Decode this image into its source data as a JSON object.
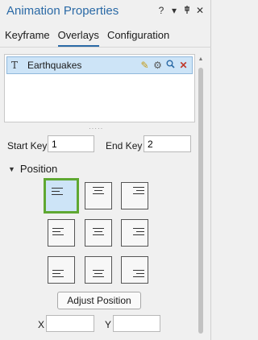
{
  "window": {
    "title": "Animation Properties",
    "help_icon": "?",
    "menu_icon": "▾",
    "pin_icon": "pin-icon",
    "close_icon": "✕"
  },
  "tabs": [
    {
      "label": "Keyframe",
      "active": false
    },
    {
      "label": "Overlays",
      "active": true
    },
    {
      "label": "Configuration",
      "active": false
    }
  ],
  "overlays": {
    "items": [
      {
        "type_icon": "T",
        "label": "Earthquakes",
        "selected": true
      }
    ]
  },
  "keys": {
    "start_label": "Start Key",
    "start_value": "1",
    "end_label": "End Key",
    "end_value": "2"
  },
  "position": {
    "header": "Position",
    "selected": "top-left",
    "grid": [
      [
        "top-left",
        "top-center",
        "top-right"
      ],
      [
        "middle-left",
        "middle-center",
        "middle-right"
      ],
      [
        "bottom-left",
        "bottom-center",
        "bottom-right"
      ]
    ],
    "adjust_label": "Adjust Position",
    "x_label": "X",
    "x_value": "",
    "y_label": "Y",
    "y_value": ""
  },
  "colors": {
    "accent": "#2b6aa6",
    "selection": "#cde4f7",
    "selected_border": "#5fa832"
  }
}
